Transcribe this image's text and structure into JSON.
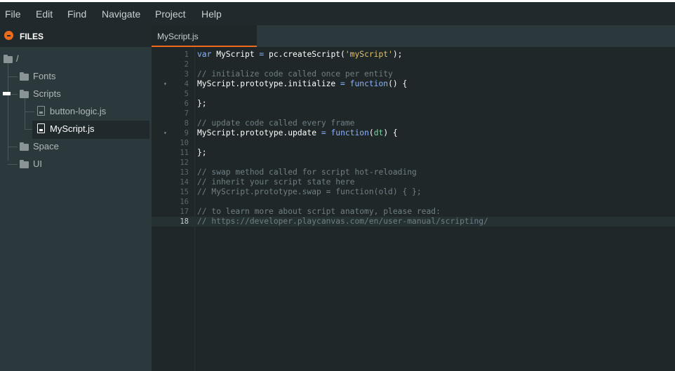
{
  "menubar": {
    "items": [
      "File",
      "Edit",
      "Find",
      "Navigate",
      "Project",
      "Help"
    ]
  },
  "sidebar": {
    "title": "FILES",
    "tree": {
      "root": "/",
      "fonts": "Fonts",
      "scripts": "Scripts",
      "button_logic": "button-logic.js",
      "myscript": "MyScript.js",
      "space": "Space",
      "ui": "UI"
    }
  },
  "editor": {
    "tab": "MyScript.js",
    "active_line": 18,
    "lines": [
      {
        "n": "1",
        "fold": "",
        "tokens": [
          [
            "kw",
            "var"
          ],
          [
            "plain",
            " MyScript "
          ],
          [
            "op",
            "="
          ],
          [
            "plain",
            " pc.createScript("
          ],
          [
            "str",
            "'myScript'"
          ],
          [
            "plain",
            ");"
          ]
        ]
      },
      {
        "n": "2",
        "fold": "",
        "tokens": []
      },
      {
        "n": "3",
        "fold": "",
        "tokens": [
          [
            "cm",
            "// initialize code called once per entity"
          ]
        ]
      },
      {
        "n": "4",
        "fold": "▾",
        "tokens": [
          [
            "plain",
            "MyScript.prototype.initialize "
          ],
          [
            "op",
            "="
          ],
          [
            "plain",
            " "
          ],
          [
            "fn",
            "function"
          ],
          [
            "plain",
            "() {"
          ]
        ]
      },
      {
        "n": "5",
        "fold": "",
        "tokens": []
      },
      {
        "n": "6",
        "fold": "",
        "tokens": [
          [
            "plain",
            "};"
          ]
        ]
      },
      {
        "n": "7",
        "fold": "",
        "tokens": []
      },
      {
        "n": "8",
        "fold": "",
        "tokens": [
          [
            "cm",
            "// update code called every frame"
          ]
        ]
      },
      {
        "n": "9",
        "fold": "▾",
        "tokens": [
          [
            "plain",
            "MyScript.prototype.update "
          ],
          [
            "op",
            "="
          ],
          [
            "plain",
            " "
          ],
          [
            "fn",
            "function"
          ],
          [
            "plain",
            "("
          ],
          [
            "param",
            "dt"
          ],
          [
            "plain",
            ") {"
          ]
        ]
      },
      {
        "n": "10",
        "fold": "",
        "tokens": []
      },
      {
        "n": "11",
        "fold": "",
        "tokens": [
          [
            "plain",
            "};"
          ]
        ]
      },
      {
        "n": "12",
        "fold": "",
        "tokens": []
      },
      {
        "n": "13",
        "fold": "",
        "tokens": [
          [
            "cm",
            "// swap method called for script hot-reloading"
          ]
        ]
      },
      {
        "n": "14",
        "fold": "",
        "tokens": [
          [
            "cm",
            "// inherit your script state here"
          ]
        ]
      },
      {
        "n": "15",
        "fold": "",
        "tokens": [
          [
            "cm",
            "// MyScript.prototype.swap = function(old) { };"
          ]
        ]
      },
      {
        "n": "16",
        "fold": "",
        "tokens": []
      },
      {
        "n": "17",
        "fold": "",
        "tokens": [
          [
            "cm",
            "// to learn more about script anatomy, please read:"
          ]
        ]
      },
      {
        "n": "18",
        "fold": "",
        "tokens": [
          [
            "cm",
            "// https://developer.playcanvas.com/en/user-manual/scripting/"
          ]
        ]
      }
    ]
  },
  "colors": {
    "accent": "#f06a1c",
    "menubar_bg": "#20292b",
    "sidebar_bg": "#2c393c",
    "editor_bg": "#1f2729"
  }
}
